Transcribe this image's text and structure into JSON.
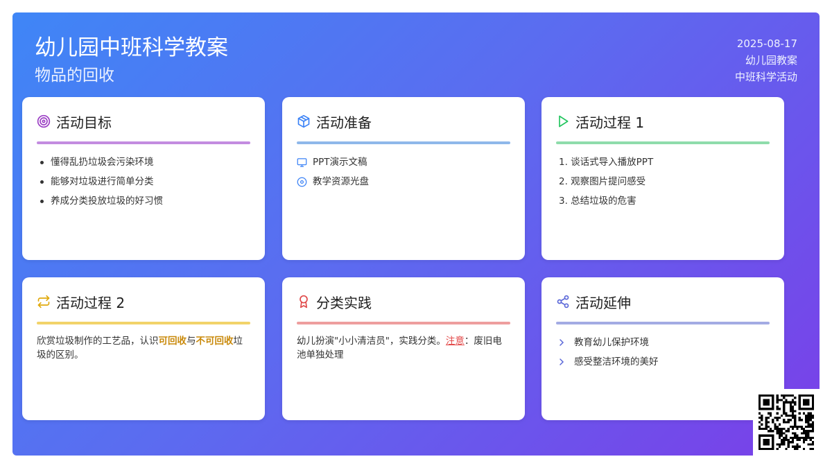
{
  "header": {
    "title": "幼儿园中班科学教案",
    "subtitle": "物品的回收",
    "date": "2025-08-17",
    "category": "幼儿园教案",
    "activity_type": "中班科学活动"
  },
  "cards": {
    "goals": {
      "title": "活动目标",
      "icon": "target-icon",
      "accent": "#c38ce0",
      "items": [
        "懂得乱扔垃圾会污染环境",
        "能够对垃圾进行简单分类",
        "养成分类投放垃圾的好习惯"
      ]
    },
    "prep": {
      "title": "活动准备",
      "icon": "cube-icon",
      "accent": "#8fb8ea",
      "items": [
        {
          "icon": "monitor-icon",
          "text": "PPT演示文稿"
        },
        {
          "icon": "disc-icon",
          "text": "教学资源光盘"
        }
      ]
    },
    "process1": {
      "title": "活动过程 1",
      "icon": "play-icon",
      "accent": "#8fdcab",
      "items": [
        "1. 谈话式导入播放PPT",
        "2. 观察图片提问感受",
        "3. 总结垃圾的危害"
      ]
    },
    "process2": {
      "title": "活动过程 2",
      "icon": "repeat-icon",
      "accent": "#f2d36a",
      "text_before": "欣赏垃圾制作的工艺品，认识",
      "highlight1": "可回收",
      "text_middle": "与",
      "highlight2": "不可回收",
      "text_after": "垃圾的区别。"
    },
    "practice": {
      "title": "分类实践",
      "icon": "award-icon",
      "accent": "#ee9e9e",
      "text_before": "幼儿扮演\"小小清洁员\"，实践分类。",
      "note_label": "注意",
      "text_after": "：废旧电池单独处理"
    },
    "extension": {
      "title": "活动延伸",
      "icon": "share-icon",
      "accent": "#a3abe3",
      "items": [
        "教育幼儿保护环境",
        "感受整洁环境的美好"
      ]
    }
  },
  "colors": {
    "gradient_start": "#3f86f6",
    "gradient_end": "#7a3fe8",
    "highlight": "#c9890a",
    "warning": "#e34b4b"
  }
}
